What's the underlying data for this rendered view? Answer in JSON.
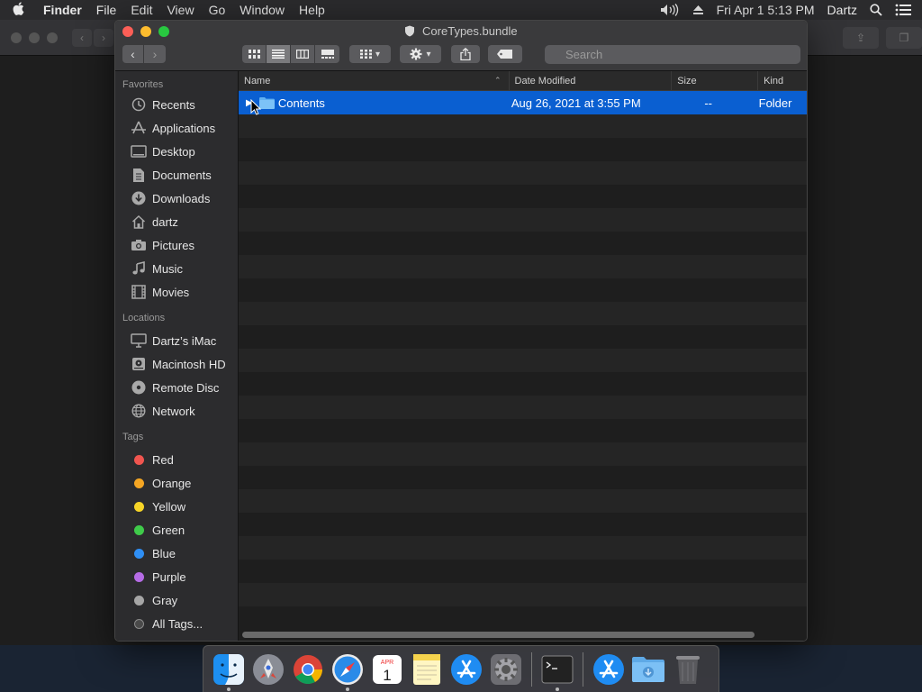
{
  "menubar": {
    "apple": "",
    "items": [
      "Finder",
      "File",
      "Edit",
      "View",
      "Go",
      "Window",
      "Help"
    ],
    "datetime": "Fri Apr 1  5:13 PM",
    "user": "Dartz"
  },
  "window": {
    "title": "CoreTypes.bundle",
    "search_placeholder": "Search"
  },
  "sidebar": {
    "favorites_title": "Favorites",
    "favorites": [
      {
        "label": "Recents",
        "icon": "clock-icon"
      },
      {
        "label": "Applications",
        "icon": "applications-icon"
      },
      {
        "label": "Desktop",
        "icon": "desktop-icon"
      },
      {
        "label": "Documents",
        "icon": "document-icon"
      },
      {
        "label": "Downloads",
        "icon": "download-icon"
      },
      {
        "label": "dartz",
        "icon": "home-icon"
      },
      {
        "label": "Pictures",
        "icon": "camera-icon"
      },
      {
        "label": "Music",
        "icon": "music-note-icon"
      },
      {
        "label": "Movies",
        "icon": "film-icon"
      }
    ],
    "locations_title": "Locations",
    "locations": [
      {
        "label": "Dartz’s iMac",
        "icon": "computer-icon"
      },
      {
        "label": "Macintosh HD",
        "icon": "hard-disk-icon"
      },
      {
        "label": "Remote Disc",
        "icon": "disc-icon"
      },
      {
        "label": "Network",
        "icon": "globe-icon"
      }
    ],
    "tags_title": "Tags",
    "tags": [
      {
        "label": "Red",
        "color": "#f0554f"
      },
      {
        "label": "Orange",
        "color": "#f5a623"
      },
      {
        "label": "Yellow",
        "color": "#f7d527"
      },
      {
        "label": "Green",
        "color": "#3fcb4a"
      },
      {
        "label": "Blue",
        "color": "#2f8ff5"
      },
      {
        "label": "Purple",
        "color": "#b66ce6"
      },
      {
        "label": "Gray",
        "color": "#a6a6a6"
      },
      {
        "label": "All Tags...",
        "color": "#5a5a5a"
      }
    ]
  },
  "columns": {
    "name": "Name",
    "date": "Date Modified",
    "size": "Size",
    "kind": "Kind"
  },
  "files": [
    {
      "name": "Contents",
      "date": "Aug 26, 2021 at 3:55 PM",
      "size": "--",
      "kind": "Folder",
      "selected": true
    }
  ],
  "dock": [
    {
      "name": "Finder",
      "icon": "finder-icon",
      "running": true
    },
    {
      "name": "Launchpad",
      "icon": "launchpad-icon",
      "running": false
    },
    {
      "name": "Chrome",
      "icon": "chrome-icon",
      "running": false
    },
    {
      "name": "Safari",
      "icon": "safari-icon",
      "running": true
    },
    {
      "name": "Calendar",
      "icon": "calendar-icon",
      "running": false,
      "month": "APR",
      "day": "1"
    },
    {
      "name": "Notes",
      "icon": "notes-icon",
      "running": false
    },
    {
      "name": "App Store",
      "icon": "app-store-icon",
      "running": false
    },
    {
      "name": "System Preferences",
      "icon": "gear-icon",
      "running": false
    },
    {
      "name": "Terminal",
      "icon": "terminal-icon",
      "running": true
    },
    {
      "name": "Applications",
      "icon": "app-store-icon",
      "running": false
    },
    {
      "name": "Downloads",
      "icon": "downloads-folder-icon",
      "running": false
    },
    {
      "name": "Trash",
      "icon": "trash-icon",
      "running": false
    }
  ]
}
